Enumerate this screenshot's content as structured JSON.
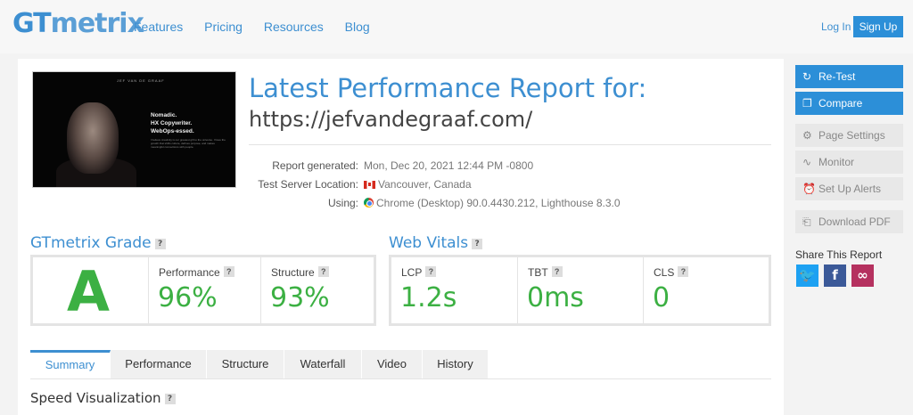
{
  "header": {
    "logo_gt": "GT",
    "logo_rest": "metrix",
    "nav": [
      "Features",
      "Pricing",
      "Resources",
      "Blog"
    ],
    "login": "Log In",
    "signup": "Sign Up"
  },
  "thumbnail": {
    "name": "JEF VAN DE GRAAF",
    "lines": [
      "Nomadic.",
      "HX Copywriter.",
      "WebOps-essed."
    ],
    "small": "I believe creativity is our greatest gift to the universe. I have the growth that shifts culture, defines purpose, and makes meaningful connections with people."
  },
  "report": {
    "title": "Latest Performance Report for:",
    "url": "https://jefvandegraaf.com/",
    "generated_label": "Report generated:",
    "generated_value": "Mon, Dec 20, 2021 12:44 PM -0800",
    "server_label": "Test Server Location:",
    "server_value": "Vancouver, Canada",
    "using_label": "Using:",
    "using_value": "Chrome (Desktop) 90.0.4430.212, Lighthouse 8.3.0"
  },
  "grade": {
    "title": "GTmetrix Grade",
    "letter": "A",
    "performance_label": "Performance",
    "performance_value": "96%",
    "structure_label": "Structure",
    "structure_value": "93%"
  },
  "vitals": {
    "title": "Web Vitals",
    "lcp_label": "LCP",
    "lcp_value": "1.2s",
    "tbt_label": "TBT",
    "tbt_value": "0ms",
    "cls_label": "CLS",
    "cls_value": "0"
  },
  "tabs": [
    "Summary",
    "Performance",
    "Structure",
    "Waterfall",
    "Video",
    "History"
  ],
  "active_tab": "Summary",
  "speed_title": "Speed Visualization",
  "help_mark": "?",
  "sidebar": {
    "retest": "Re-Test",
    "compare": "Compare",
    "page_settings": "Page Settings",
    "monitor": "Monitor",
    "setup_alerts": "Set Up Alerts",
    "download_pdf": "Download PDF",
    "share_label": "Share This Report"
  },
  "colors": {
    "accent": "#3d8fd1",
    "grade_green": "#3cb043",
    "twitter": "#1da1f2",
    "facebook": "#3b5998",
    "link": "#b5315f"
  },
  "icons": [
    "refresh-icon",
    "compare-icon",
    "gear-icon",
    "pulse-icon",
    "alarm-icon",
    "pdf-icon",
    "twitter-icon",
    "facebook-icon",
    "link-icon",
    "canada-flag-icon",
    "chrome-icon",
    "help-icon"
  ]
}
